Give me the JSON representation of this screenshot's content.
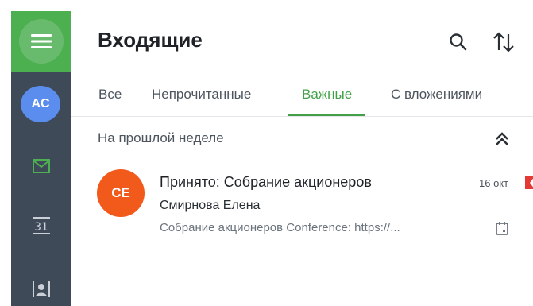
{
  "rail": {
    "menu_icon": "hamburger-icon",
    "avatar_initials": "AC",
    "mail_icon": "mail-icon",
    "calendar_label": "31",
    "contacts_icon": "contacts-icon"
  },
  "header": {
    "title": "Входящие",
    "search_icon": "search-icon",
    "sort_icon": "sort-icon"
  },
  "tabs": [
    {
      "label": "Все",
      "active": false
    },
    {
      "label": "Непрочитанные",
      "active": false
    },
    {
      "label": "Важные",
      "active": true
    },
    {
      "label": "С вложениями",
      "active": false
    }
  ],
  "section": {
    "label": "На прошлой неделе",
    "collapse_icon": "double-chevron-up-icon"
  },
  "messages": [
    {
      "initials": "CE",
      "subject": "Принято: Собрание акционеров",
      "sender": "Смирнова Елена",
      "preview": "Собрание акционеров Conference: https://...",
      "date": "16 окт",
      "important": true,
      "calendar_icon": "calendar-icon"
    }
  ],
  "colors": {
    "accent": "#43a047",
    "rail_bg": "#3f4a58",
    "avatar_blue": "#5b8def",
    "avatar_orange": "#f25a1c",
    "flag_red": "#e53935"
  }
}
